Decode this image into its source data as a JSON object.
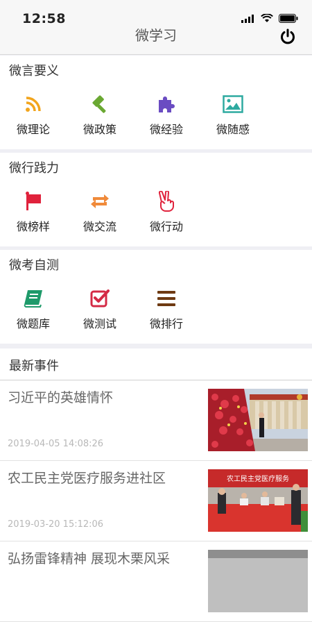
{
  "status": {
    "time": "12:58"
  },
  "nav": {
    "title": "微学习"
  },
  "sections": [
    {
      "title": "微言要义",
      "items": [
        {
          "label": "微理论",
          "icon": "rss-icon",
          "color": "#f2a51d"
        },
        {
          "label": "微政策",
          "icon": "gavel-icon",
          "color": "#6aa832"
        },
        {
          "label": "微经验",
          "icon": "puzzle-icon",
          "color": "#6a4cc2"
        },
        {
          "label": "微随感",
          "icon": "image-icon",
          "color": "#2eaaa0"
        }
      ]
    },
    {
      "title": "微行践力",
      "items": [
        {
          "label": "微榜样",
          "icon": "flag-icon",
          "color": "#e0223c"
        },
        {
          "label": "微交流",
          "icon": "exchange-icon",
          "color": "#f08a3a"
        },
        {
          "label": "微行动",
          "icon": "hand-peace-icon",
          "color": "#e0223c"
        }
      ]
    },
    {
      "title": "微考自测",
      "items": [
        {
          "label": "微题库",
          "icon": "book-icon",
          "color": "#1e9a6a"
        },
        {
          "label": "微测试",
          "icon": "checkbox-icon",
          "color": "#d42a45"
        },
        {
          "label": "微排行",
          "icon": "list-icon",
          "color": "#6e3a12"
        }
      ]
    }
  ],
  "news": {
    "header": "最新事件",
    "items": [
      {
        "title": "习近平的英雄情怀",
        "time": "2019-04-05 14:08:26"
      },
      {
        "title": "农工民主党医疗服务进社区",
        "time": "2019-03-20 15:12:06"
      },
      {
        "title": "弘扬雷锋精神 展现木栗风采",
        "time": ""
      }
    ]
  },
  "thumb_banner_text": "农工民主党医疗服务"
}
